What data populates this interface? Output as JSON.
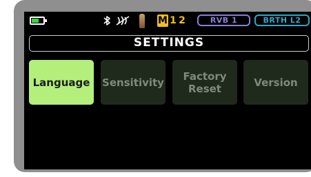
{
  "status": {
    "battery": {
      "level": 0.6,
      "color": "#35d83a"
    },
    "icons": [
      "bluetooth-icon",
      "mute-icon",
      "microphone-icon"
    ],
    "memory": {
      "m_label": "M",
      "slot1": "1",
      "slot2": "2"
    },
    "reverb_label": "RVB 1",
    "breath_label": "BRTH L2"
  },
  "header": {
    "title": "SETTINGS"
  },
  "tiles": [
    {
      "label": "Language",
      "selected": true
    },
    {
      "label": "Sensitivity",
      "selected": false
    },
    {
      "label": "Factory\nReset",
      "selected": false
    },
    {
      "label": "Version",
      "selected": false
    }
  ],
  "colors": {
    "selected_tile": "#b4ef7b",
    "tile": "#1f2a1c",
    "memory": "#f0c020",
    "reverb": "#8a7fd6",
    "breath": "#2fa8c8"
  }
}
